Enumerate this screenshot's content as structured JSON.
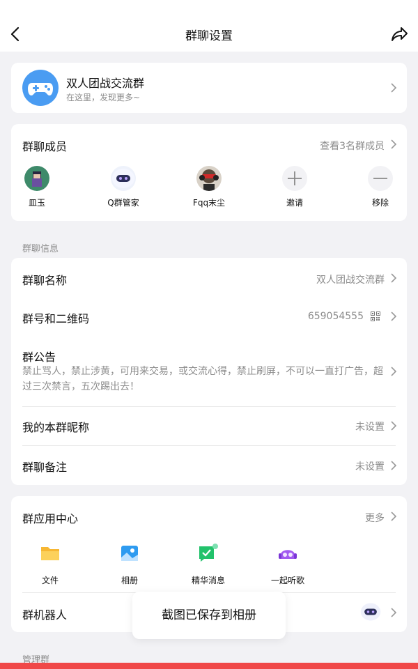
{
  "header": {
    "title": "群聊设置",
    "back_icon": "chevron-left-icon",
    "share_icon": "share-icon"
  },
  "group": {
    "name": "双人团战交流群",
    "subtitle": "在这里，发现更多~",
    "avatar_icon": "gamepad-icon",
    "avatar_color": "#4a9cf2"
  },
  "members": {
    "title": "群聊成员",
    "view_all": "查看3名群成员",
    "list": [
      {
        "name": "皿玉"
      },
      {
        "name": "Q群管家"
      },
      {
        "name": "Fqq末尘"
      },
      {
        "name": "邀请"
      },
      {
        "name": "移除"
      }
    ]
  },
  "info_section": {
    "label": "群聊信息",
    "group_name_label": "群聊名称",
    "group_name_value": "双人团战交流群",
    "group_id_label": "群号和二维码",
    "group_id_value": "659054555",
    "notice_label": "群公告",
    "notice_text": "禁止骂人，禁止涉黄，可用来交易，或交流心得，禁止刷屏，不可以一直打广告，超过三次禁言，五次踢出去！",
    "nickname_label": "我的本群昵称",
    "nickname_value": "未设置",
    "remark_label": "群聊备注",
    "remark_value": "未设置"
  },
  "apps": {
    "title": "群应用中心",
    "more": "更多",
    "items": [
      {
        "label": "文件",
        "icon": "folder-icon"
      },
      {
        "label": "相册",
        "icon": "album-icon"
      },
      {
        "label": "精华消息",
        "icon": "essence-message-icon"
      },
      {
        "label": "一起听歌",
        "icon": "listen-together-icon"
      }
    ],
    "robot_label": "群机器人"
  },
  "manage_section": {
    "label": "管理群"
  },
  "toast": {
    "text": "截图已保存到相册"
  },
  "colors": {
    "accent_blue": "#4a9cf2",
    "bottom_bar": "#f04848",
    "text_secondary": "#8c8c8c"
  }
}
